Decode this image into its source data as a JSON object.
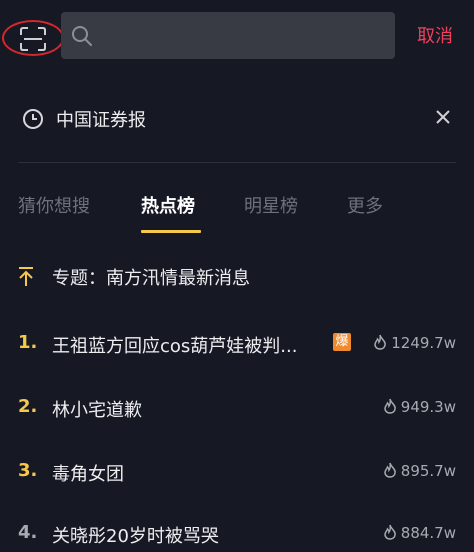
{
  "search": {
    "placeholder": "",
    "cancel_label": "取消"
  },
  "history": {
    "term": "中国证券报"
  },
  "tabs": [
    {
      "label": "猜你想搜",
      "active": false
    },
    {
      "label": "热点榜",
      "active": true
    },
    {
      "label": "明星榜",
      "active": false
    },
    {
      "label": "更多",
      "active": false
    }
  ],
  "pinned": {
    "text": "专题：南方汛情最新消息"
  },
  "trending": [
    {
      "rank": "1.",
      "title": "王祖蓝方回应cos葫芦娃被判...",
      "badge": "爆",
      "heat": "1249.7w"
    },
    {
      "rank": "2.",
      "title": "林小宅道歉",
      "heat": "949.3w"
    },
    {
      "rank": "3.",
      "title": "毒角女团",
      "heat": "895.7w"
    },
    {
      "rank": "4.",
      "title": "关晓彤20岁时被骂哭",
      "heat": "884.7w"
    }
  ],
  "colors": {
    "background": "#161823",
    "accent_red": "#f0405a",
    "rank_gold": "#f6c94a",
    "badge_orange": "#f08a2e"
  },
  "icons": [
    "scan-icon",
    "search-icon",
    "clock-icon",
    "close-icon",
    "pin-top-icon",
    "flame-icon"
  ]
}
